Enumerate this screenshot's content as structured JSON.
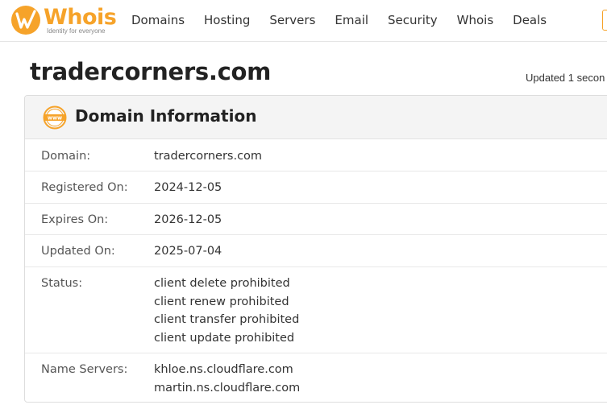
{
  "header": {
    "logo": {
      "name": "Whois",
      "tagline": "Identity for everyone"
    },
    "nav": [
      "Domains",
      "Hosting",
      "Servers",
      "Email",
      "Security",
      "Whois",
      "Deals"
    ]
  },
  "page": {
    "domain_title": "tradercorners.com",
    "updated_text": "Updated 1 secon"
  },
  "card": {
    "title": "Domain Information",
    "icon_label": "www",
    "rows": {
      "domain": {
        "label": "Domain:",
        "value": "tradercorners.com"
      },
      "registered": {
        "label": "Registered On:",
        "value": "2024-12-05"
      },
      "expires": {
        "label": "Expires On:",
        "value": "2026-12-05"
      },
      "updated": {
        "label": "Updated On:",
        "value": "2025-07-04"
      },
      "status": {
        "label": "Status:",
        "values": [
          "client delete prohibited",
          "client renew prohibited",
          "client transfer prohibited",
          "client update prohibited"
        ]
      },
      "nameservers": {
        "label": "Name Servers:",
        "values": [
          "khloe.ns.cloudflare.com",
          "martin.ns.cloudflare.com"
        ]
      }
    }
  },
  "colors": {
    "brand_orange": "#f6a32a",
    "text": "#333333",
    "header_bg": "#f4f4f4"
  }
}
